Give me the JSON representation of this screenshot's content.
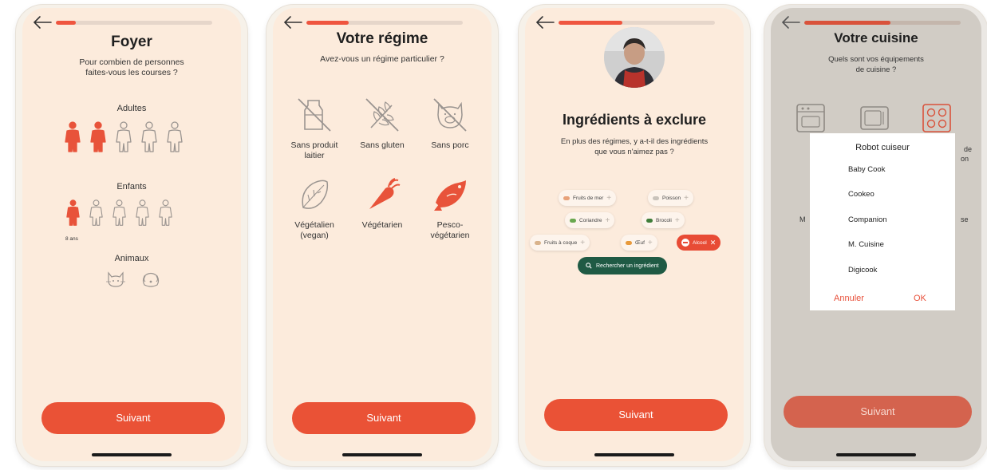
{
  "colors": {
    "accent": "#ea5236",
    "cream": "#fcebdc",
    "green": "#1f5a44",
    "muted": "#b9b1a8"
  },
  "screens": [
    {
      "title": "Foyer",
      "subtitle_line1": "Pour combien de personnes",
      "subtitle_line2": "faites-vous les courses ?",
      "progress": 0.13,
      "adults_label": "Adultes",
      "adults_selected": 2,
      "adults_total": 5,
      "children_label": "Enfants",
      "children_selected": 1,
      "children_total": 5,
      "child_age": "8 ans",
      "animals_label": "Animaux",
      "animals_icons": [
        "cat-icon",
        "dog-icon"
      ],
      "next_label": "Suivant"
    },
    {
      "title": "Votre régime",
      "subtitle": "Avez-vous un régime particulier ?",
      "progress": 0.27,
      "options": [
        {
          "line1": "Sans produit",
          "line2": "laitier",
          "icon": "milk-crossed-icon",
          "selected": false
        },
        {
          "line1": "Sans gluten",
          "line2": "",
          "icon": "wheat-crossed-icon",
          "selected": false
        },
        {
          "line1": "Sans porc",
          "line2": "",
          "icon": "pig-crossed-icon",
          "selected": false
        },
        {
          "line1": "Végétalien",
          "line2": "(vegan)",
          "icon": "leaf-icon",
          "selected": false
        },
        {
          "line1": "Végétarien",
          "line2": "",
          "icon": "carrot-icon",
          "selected": true
        },
        {
          "line1": "Pesco-",
          "line2": "végétarien",
          "icon": "fish-icon",
          "selected": true
        }
      ],
      "next_label": "Suivant"
    },
    {
      "title": "Ingrédients à exclure",
      "subtitle_line1": "En plus des régimes, y a-t-il des ingrédients",
      "subtitle_line2": "que vous n'aimez pas ?",
      "progress": 0.41,
      "chips": [
        {
          "label": "Fruits de mer",
          "color": "#e8a27a",
          "active": false
        },
        {
          "label": "Poisson",
          "color": "#c9c3bb",
          "active": false
        },
        {
          "label": "Coriandre",
          "color": "#6aa84f",
          "active": false
        },
        {
          "label": "Brocoli",
          "color": "#3f7d3a",
          "active": false
        },
        {
          "label": "Fruits à coque",
          "color": "#d9b38c",
          "active": false
        },
        {
          "label": "Œuf",
          "color": "#e89a3c",
          "active": false
        },
        {
          "label": "Alcool",
          "color": "#ffffff",
          "active": true
        }
      ],
      "search_label": "Rechercher un ingrédient",
      "next_label": "Suivant"
    },
    {
      "title": "Votre cuisine",
      "subtitle_line1": "Quels sont vos équipements",
      "subtitle_line2": "de cuisine ?",
      "progress": 0.55,
      "peek_right_1": "de",
      "peek_right_2": "on",
      "peek_left": "M",
      "peek_right_3": "se",
      "modal": {
        "title": "Robot cuiseur",
        "options": [
          "Baby Cook",
          "Cookeo",
          "Companion",
          "M. Cuisine",
          "Digicook"
        ],
        "cancel": "Annuler",
        "ok": "OK"
      },
      "next_label": "Suivant"
    }
  ]
}
